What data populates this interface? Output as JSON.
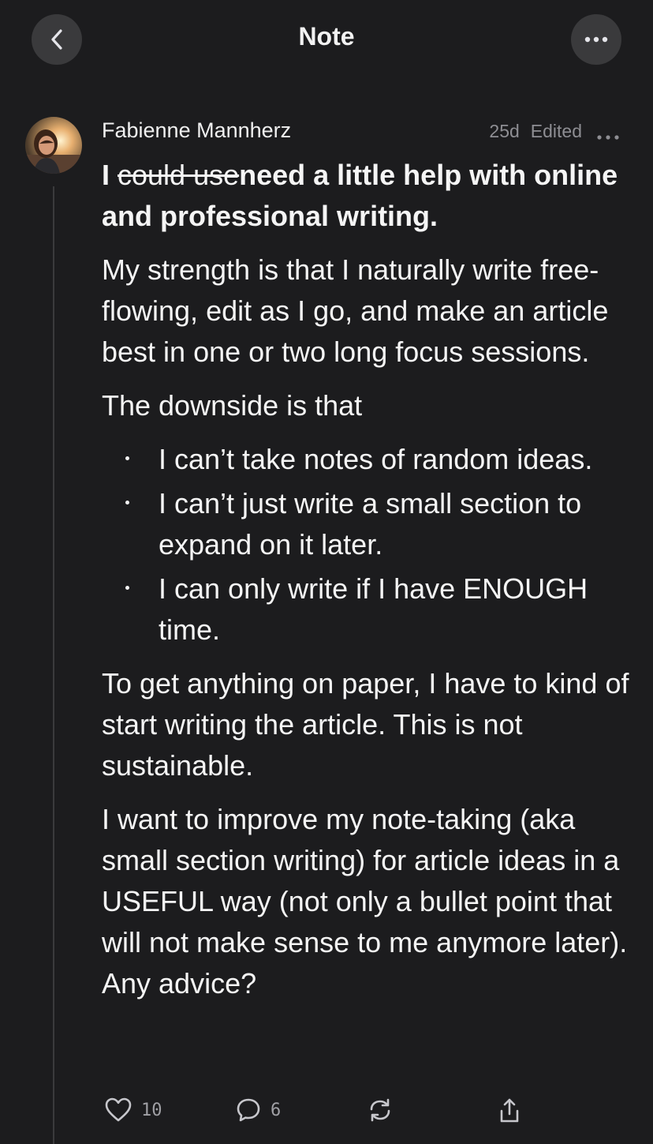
{
  "header": {
    "title": "Note",
    "back_icon": "chevron-left-icon",
    "more_icon": "ellipsis-icon"
  },
  "post": {
    "author": "Fabienne Mannherz",
    "age": "25d",
    "edited": "Edited",
    "lead_struck": "could use",
    "lead_prefix": "I ",
    "lead_rest": "need a little help with online and professional writing.",
    "paragraphs": [
      "My strength is that I naturally write free-flowing, edit as I go, and make an article best in one or two long focus sessions.",
      "The downside is that"
    ],
    "bullets": [
      "I can’t take notes of random ideas.",
      "I can’t just write a small section to expand on it later.",
      "I can only write if I have ENOUGH time."
    ],
    "paragraphs_after": [
      "To get anything on paper, I have to kind of start writing the article. This is not sustainable.",
      "I want to improve my note-taking (aka small section writing) for article ideas in a USEFUL way (not only a bullet point that will not make sense to me anymore later). Any advice?"
    ]
  },
  "actions": {
    "likes": "10",
    "comments": "6"
  },
  "colors": {
    "background": "#1c1c1e",
    "button_bg": "#3a3a3c",
    "muted_text": "#8e8e93"
  }
}
